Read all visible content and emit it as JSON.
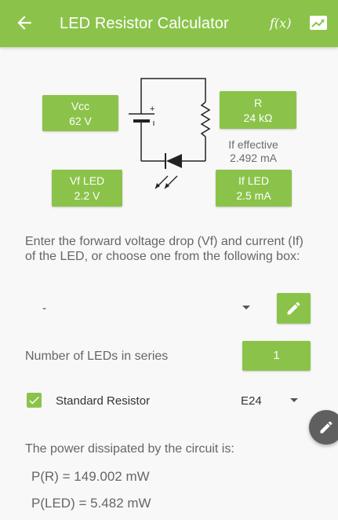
{
  "appbar": {
    "title": "LED Resistor Calculator",
    "fx_label": "f(x)",
    "color": "#8bc34a",
    "icons": [
      "arrow-back-icon",
      "chart-icon"
    ]
  },
  "circuit": {
    "vcc": {
      "label": "Vcc",
      "value": "62 V"
    },
    "r": {
      "label": "R",
      "value": "24 kΩ"
    },
    "vf_led": {
      "label": "Vf LED",
      "value": "2.2 V"
    },
    "if_led": {
      "label": "If LED",
      "value": "2.5 mA"
    },
    "if_effective": {
      "label": "If effective",
      "value": "2.492 mA"
    },
    "battery_polarity": "+"
  },
  "instructions": "Enter the forward voltage drop (Vf) and current (If) of the LED, or choose one from the following box:",
  "led_dropdown": {
    "selected": "-"
  },
  "leds_in_series": {
    "label": "Number of LEDs in series",
    "value": "1"
  },
  "standard_resistor": {
    "label": "Standard Resistor",
    "checked": true,
    "series": "E24"
  },
  "power": {
    "label": "The power dissipated by the circuit is:",
    "p_r": "P(R) = 149.002 mW",
    "p_led": "P(LED) = 5.482 mW"
  },
  "colors": {
    "accent": "#8bc34a",
    "fab": "#5f5f5f"
  }
}
